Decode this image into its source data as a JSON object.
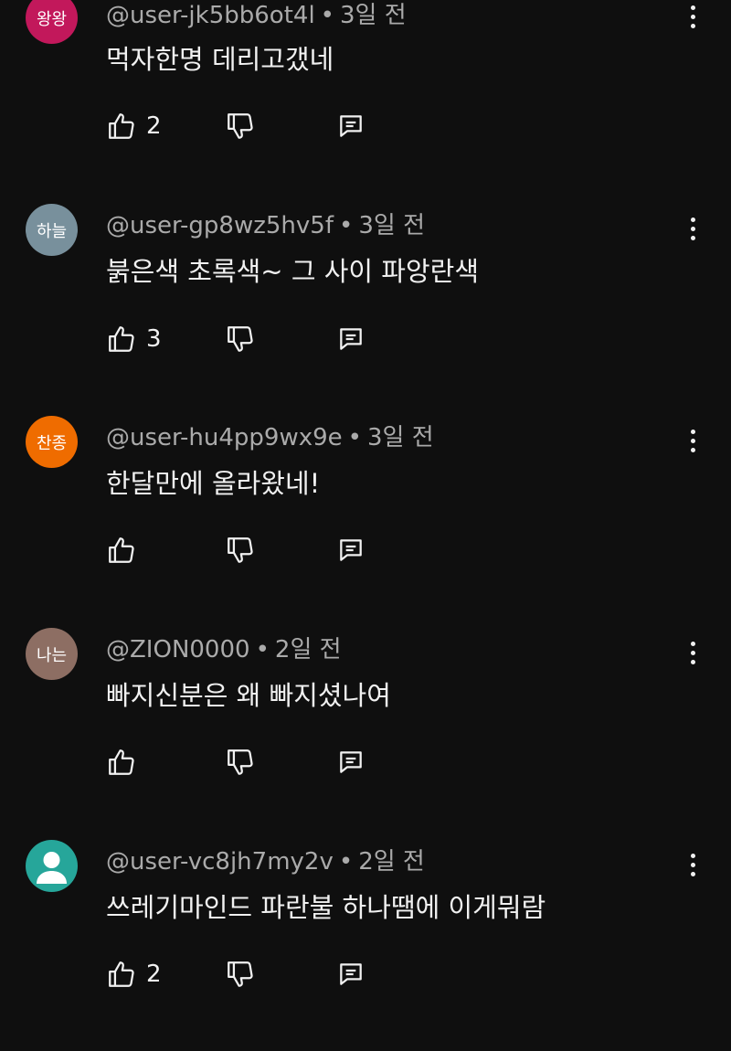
{
  "comments": [
    {
      "avatar_text": "왕왕",
      "avatar_color": "#c2185b",
      "author": "@user-jk5bb6ot4l",
      "time": "3일 전",
      "text": "먹자한명 데리고갰네",
      "likes": "2"
    },
    {
      "avatar_text": "하늘",
      "avatar_color": "#78909c",
      "author": "@user-gp8wz5hv5f",
      "time": "3일 전",
      "text": "붉은색 초록색~ 그 사이 파앙란색",
      "likes": "3"
    },
    {
      "avatar_text": "찬종",
      "avatar_color": "#ef6c00",
      "author": "@user-hu4pp9wx9e",
      "time": "3일 전",
      "text": "한달만에 올라왔네!",
      "likes": ""
    },
    {
      "avatar_text": "나는",
      "avatar_color": "#8d6e63",
      "author": "@ZION0000",
      "time": "2일 전",
      "text": "빠지신분은 왜 빠지셨나여",
      "likes": ""
    },
    {
      "avatar_text": "",
      "avatar_icon": "person-icon",
      "avatar_color": "#26a69a",
      "author": "@user-vc8jh7my2v",
      "time": "2일 전",
      "text": "쓰레기마인드 파란불 하나땜에 이게뭐람",
      "likes": "2"
    }
  ],
  "separator": "•",
  "icons": {
    "like": "thumbs-up-icon",
    "dislike": "thumbs-down-icon",
    "reply": "reply-icon",
    "more": "more-vert-icon"
  }
}
